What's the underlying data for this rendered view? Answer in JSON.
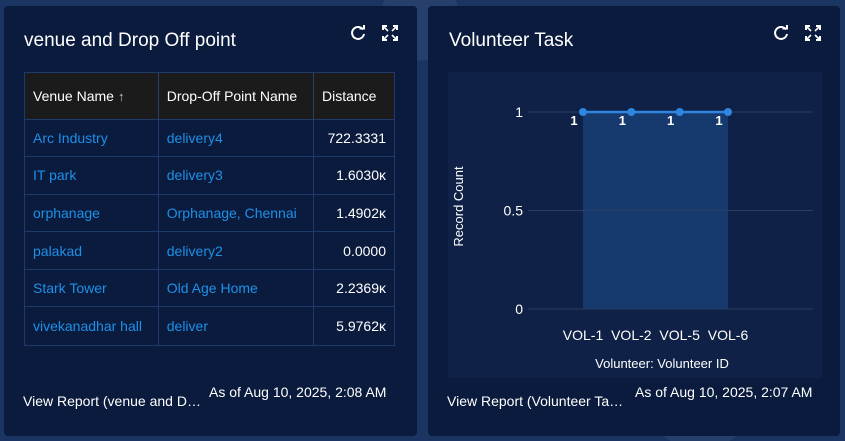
{
  "venue_card": {
    "title": "venue and Drop Off point",
    "table": {
      "headers": [
        "Venue Name",
        "Drop-Off Point Name",
        "Distance"
      ],
      "sort_indicator": "↑",
      "rows": [
        [
          "Arc Industry",
          "delivery4",
          "722.3331"
        ],
        [
          "IT park",
          "delivery3",
          "1.6030ĸ"
        ],
        [
          "orphanage",
          "Orphanage, Chennai",
          "1.4902ĸ"
        ],
        [
          "palakad",
          "delivery2",
          "0.0000"
        ],
        [
          "Stark Tower",
          "Old Age Home",
          "2.2369ĸ"
        ],
        [
          "vivekanadhar hall",
          "deliver",
          "5.9762ĸ"
        ]
      ]
    },
    "footer": {
      "view_report": "View Report (venue and Drop Off point)",
      "as_of": "As of Aug 10, 2025, 2:08 AM"
    }
  },
  "volunteer_card": {
    "title": "Volunteer Task",
    "footer": {
      "view_report": "View Report (Volunteer Task)",
      "as_of": "As of Aug 10, 2025, 2:07 AM"
    }
  },
  "icons": {
    "refresh": "refresh-icon",
    "expand": "expand-icon"
  },
  "colors": {
    "card_bg": "#0a1b3d",
    "link": "#1e90e8",
    "line": "#2f86e0",
    "plot_fill": "#163a6e"
  },
  "chart_data": {
    "type": "line",
    "title": "",
    "xlabel": "Volunteer: Volunteer ID",
    "ylabel": "Record Count",
    "categories": [
      "VOL-1",
      "VOL-2",
      "VOL-5",
      "VOL-6"
    ],
    "values": [
      1,
      1,
      1,
      1
    ],
    "data_labels": [
      "1",
      "1",
      "1",
      "1"
    ],
    "ylim": [
      0,
      1
    ],
    "y_ticks": [
      "0",
      "0.5",
      "1"
    ],
    "grid": true
  }
}
